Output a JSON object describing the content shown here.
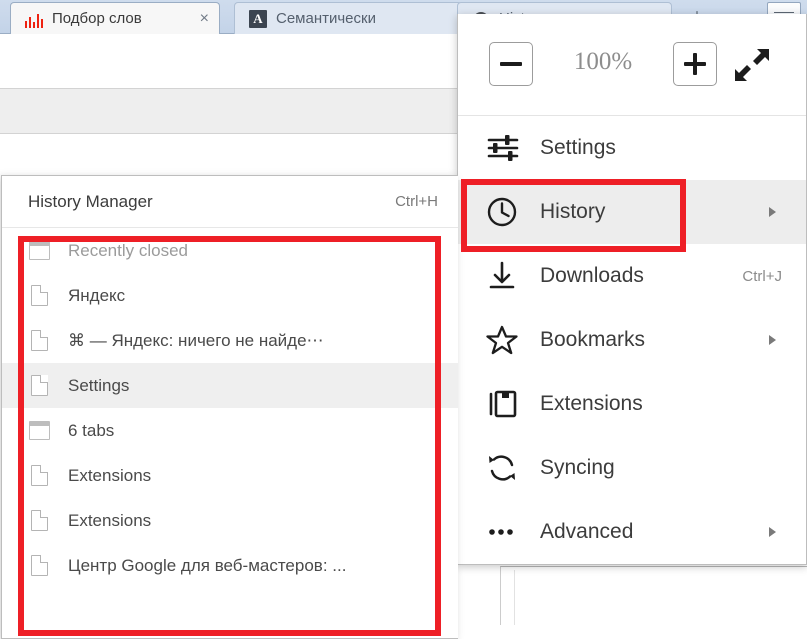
{
  "browser": {
    "tabs": [
      {
        "title": "Подбор слов",
        "icon": "wordstat-bars-icon",
        "state": "active",
        "close_label": "×"
      },
      {
        "title": "Семантически",
        "icon": "letter-a-icon",
        "state": "inactive"
      },
      {
        "title": "History",
        "icon": "clock-icon",
        "state": "inactive"
      }
    ],
    "new_tab_label": "+",
    "window_menu_icon": "hamburger-icon"
  },
  "browser_menu": {
    "zoom": {
      "zoom_out_icon": "minus-icon",
      "level": "100%",
      "zoom_in_icon": "plus-icon",
      "fullscreen_icon": "fullscreen-arrows-icon"
    },
    "items": [
      {
        "label": "Settings",
        "icon": "sliders-icon",
        "shortcut": "",
        "submenu": false,
        "highlighted": false
      },
      {
        "label": "History",
        "icon": "clock-icon",
        "shortcut": "",
        "submenu": true,
        "highlighted": true
      },
      {
        "label": "Downloads",
        "icon": "download-arrow-icon",
        "shortcut": "Ctrl+J",
        "submenu": false,
        "highlighted": false
      },
      {
        "label": "Bookmarks",
        "icon": "star-icon",
        "shortcut": "",
        "submenu": true,
        "highlighted": false
      },
      {
        "label": "Extensions",
        "icon": "extensions-icon",
        "shortcut": "",
        "submenu": false,
        "highlighted": false
      },
      {
        "label": "Syncing",
        "icon": "sync-arrows-icon",
        "shortcut": "",
        "submenu": false,
        "highlighted": false
      },
      {
        "label": "Advanced",
        "icon": "ellipsis-icon",
        "shortcut": "",
        "submenu": true,
        "highlighted": false
      }
    ]
  },
  "history_submenu": {
    "manager": {
      "label": "History Manager",
      "shortcut": "Ctrl+H"
    },
    "entries": [
      {
        "label": "Recently closed",
        "icon": "window-icon",
        "muted": true,
        "highlighted": false
      },
      {
        "label": "Яндекс",
        "icon": "page-icon",
        "muted": false,
        "highlighted": false
      },
      {
        "label": "⌘ — Яндекс: ничего не найде⋯",
        "icon": "page-icon",
        "muted": false,
        "highlighted": false
      },
      {
        "label": "Settings",
        "icon": "page-icon",
        "muted": false,
        "highlighted": true
      },
      {
        "label": "6 tabs",
        "icon": "window-icon",
        "muted": false,
        "highlighted": false
      },
      {
        "label": "Extensions",
        "icon": "page-icon",
        "muted": false,
        "highlighted": false
      },
      {
        "label": "Extensions",
        "icon": "page-icon",
        "muted": false,
        "highlighted": false
      },
      {
        "label": "Центр Google для веб-мастеров: ...",
        "icon": "page-icon",
        "muted": false,
        "highlighted": false
      }
    ]
  },
  "annotations": {
    "color": "#ee1f26",
    "boxes": [
      {
        "name": "history-menu-item-highlight"
      },
      {
        "name": "history-entries-highlight"
      }
    ]
  }
}
